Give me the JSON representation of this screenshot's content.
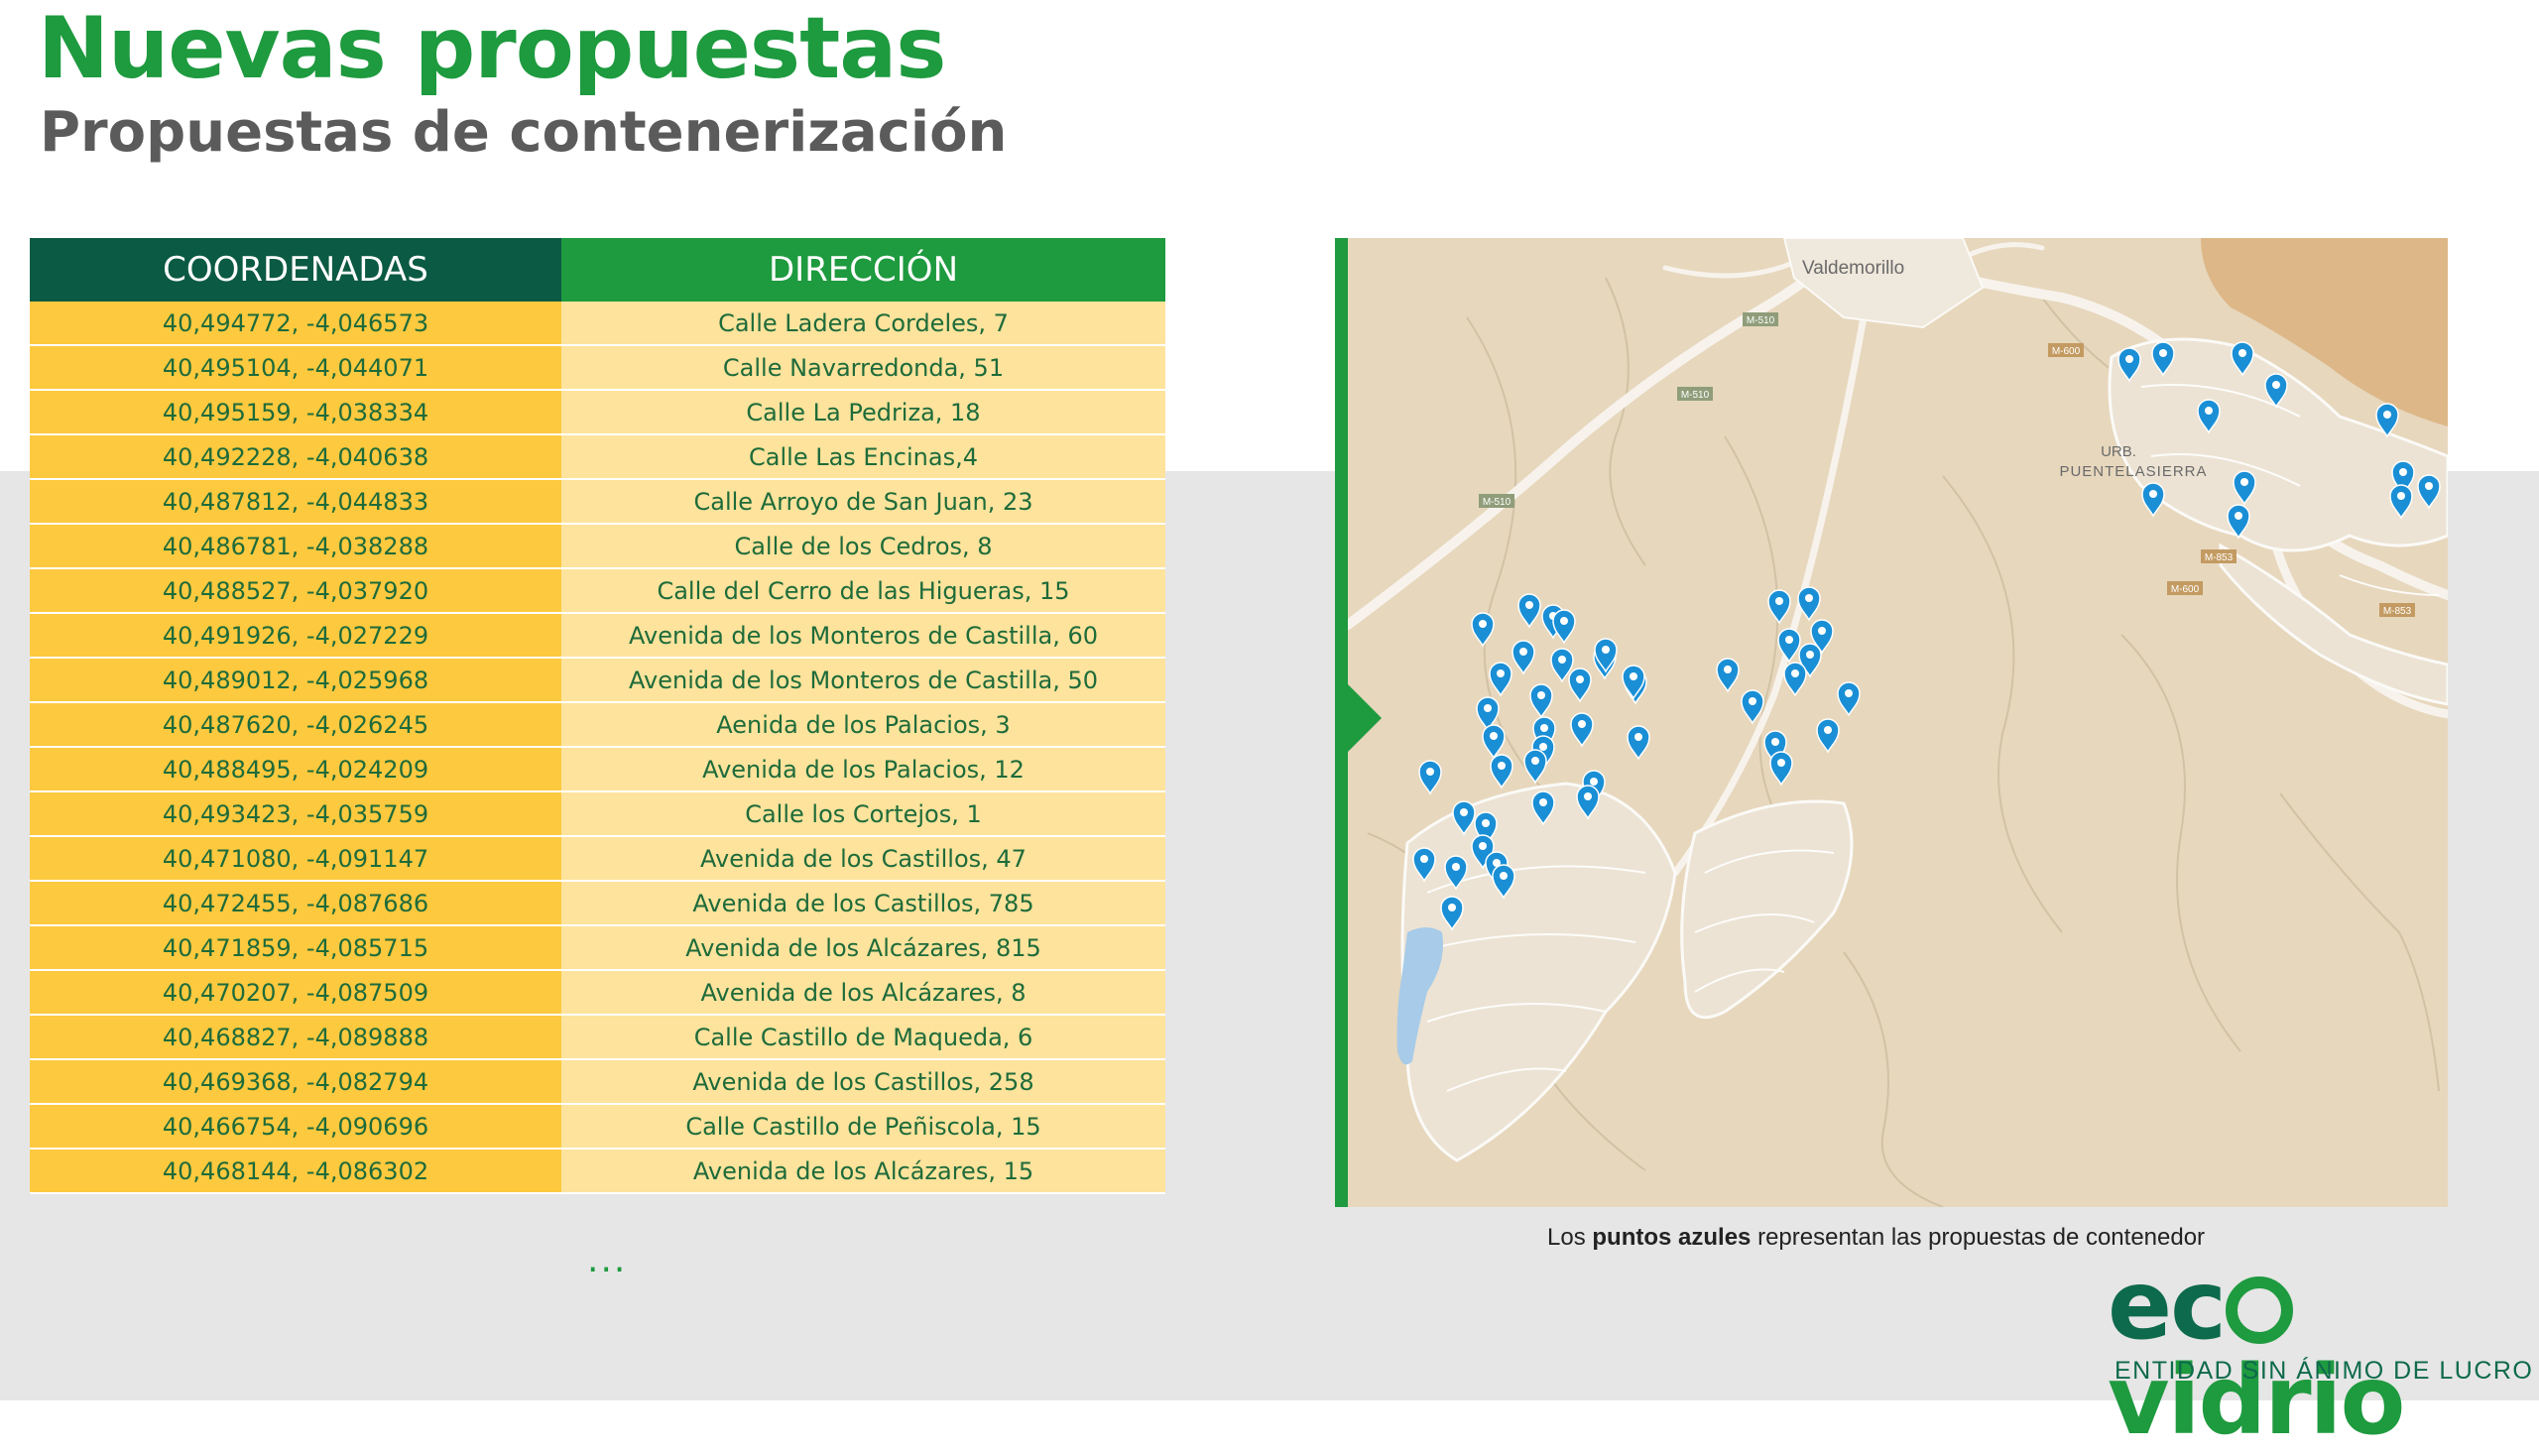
{
  "title": "Nuevas propuestas",
  "subtitle": "Propuestas de contenerización",
  "table": {
    "headers": [
      "COORDENADAS",
      "DIRECCIÓN"
    ],
    "rows": [
      [
        "40,494772, -4,046573",
        "Calle Ladera Cordeles, 7"
      ],
      [
        "40,495104, -4,044071",
        "Calle Navarredonda, 51"
      ],
      [
        "40,495159, -4,038334",
        "Calle La Pedriza, 18"
      ],
      [
        "40,492228, -4,040638",
        "Calle Las Encinas,4"
      ],
      [
        "40,487812, -4,044833",
        "Calle Arroyo de San Juan, 23"
      ],
      [
        "40,486781, -4,038288",
        "Calle de los Cedros, 8"
      ],
      [
        "40,488527, -4,037920",
        "Calle del Cerro de las Higueras, 15"
      ],
      [
        "40,491926, -4,027229",
        "Avenida de los Monteros de Castilla, 60"
      ],
      [
        "40,489012, -4,025968",
        "Avenida de los Monteros de Castilla, 50"
      ],
      [
        "40,487620, -4,026245",
        "Aenida de los Palacios, 3"
      ],
      [
        "40,488495, -4,024209",
        "Avenida de los Palacios, 12"
      ],
      [
        "40,493423, -4,035759",
        "Calle los Cortejos, 1"
      ],
      [
        "40,471080, -4,091147",
        "Avenida de los Castillos, 47"
      ],
      [
        "40,472455, -4,087686",
        "Avenida de los Castillos, 785"
      ],
      [
        "40,471859, -4,085715",
        "Avenida de los Alcázares, 815"
      ],
      [
        "40,470207, -4,087509",
        "Avenida de los Alcázares, 8"
      ],
      [
        "40,468827, -4,089888",
        "Calle Castillo de Maqueda, 6"
      ],
      [
        "40,469368, -4,082794",
        "Avenida de los Castillos, 258"
      ],
      [
        "40,466754, -4,090696",
        "Calle Castillo de Peñiscola, 15"
      ],
      [
        "40,468144, -4,086302",
        "Avenida de los Alcázares, 15"
      ]
    ],
    "more": "..."
  },
  "map": {
    "labels": {
      "town": "Valdemorillo",
      "urb_line1": "URB.",
      "urb_line2": "PUENTELASIERRA",
      "road_m510": "M-510",
      "road_m600": "M-600",
      "road_m853": "M-853"
    },
    "marker_color": "#1a8fd6",
    "marker_count": 57
  },
  "caption": {
    "before": "Los ",
    "bold": "puntos azules",
    "after": " representan las propuestas de contenedor"
  },
  "logo": {
    "word_pre": "ec",
    "word_post": "vidrio",
    "tagline": "ENTIDAD SIN ÁNIMO DE LUCRO"
  },
  "colors": {
    "title_green": "#1e9a3f",
    "header_dark": "#0b5a43",
    "coord_cell": "#fdc93f",
    "dir_cell": "#fde39c"
  }
}
